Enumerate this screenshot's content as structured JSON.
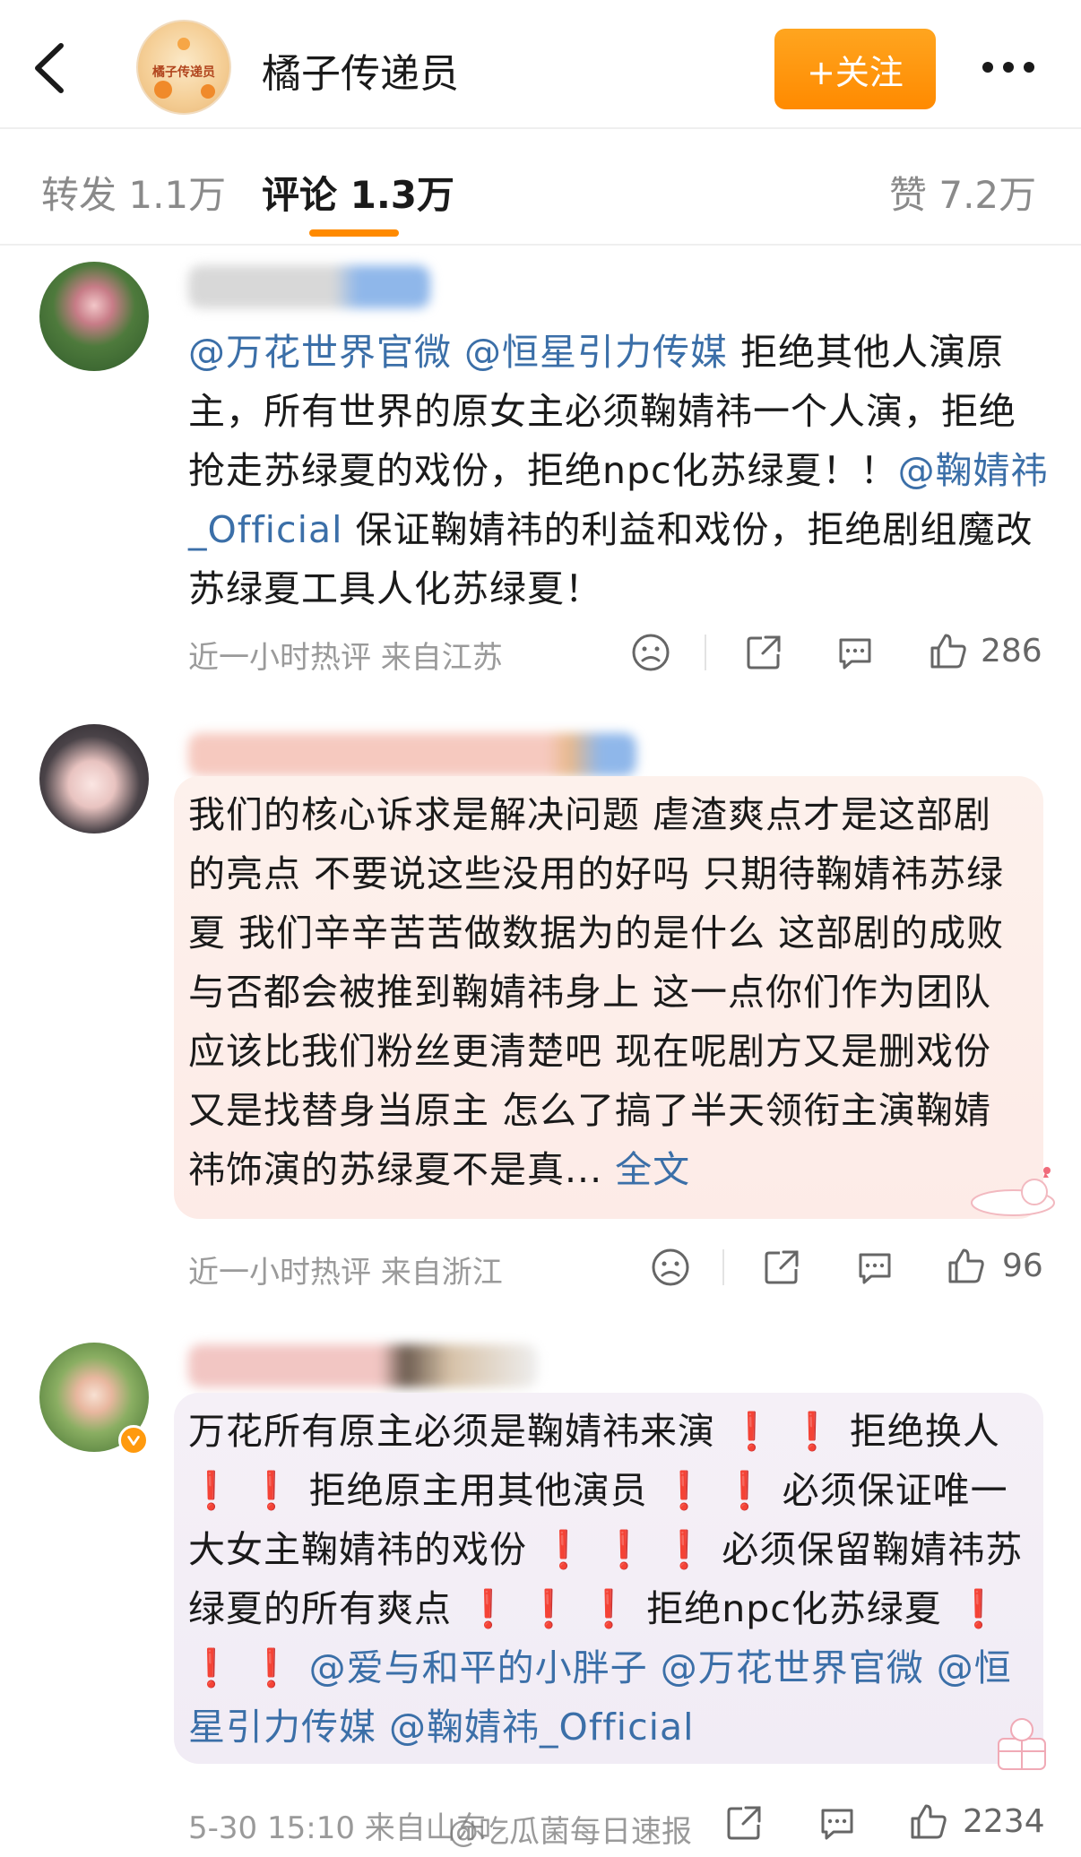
{
  "header": {
    "title": "橘子传递员",
    "avatar_text": "橘子传递员",
    "follow_label": "+关注"
  },
  "tabs": {
    "repost": "转发 1.1万",
    "comments": "评论 1.3万",
    "likes": "赞 7.2万"
  },
  "comments": [
    {
      "segments": [
        {
          "type": "mention",
          "text": "@万花世界官微"
        },
        {
          "type": "text",
          "text": " "
        },
        {
          "type": "mention",
          "text": "@恒星引力传媒"
        },
        {
          "type": "text",
          "text": " 拒绝其他人演原主，所有世界的原女主必须鞠婧祎一个人演，拒绝抢走苏绿夏的戏份，拒绝npc化苏绿夏！！"
        },
        {
          "type": "mention",
          "text": "@鞠婧祎_Official"
        },
        {
          "type": "text",
          "text": " 保证鞠婧祎的利益和戏份，拒绝剧组魔改苏绿夏工具人化苏绿夏！"
        }
      ],
      "meta": "近一小时热评  来自江苏",
      "likes": "286"
    },
    {
      "segments": [
        {
          "type": "text",
          "text": "我们的核心诉求是解决问题 虐渣爽点才是这部剧的亮点 不要说这些没用的好吗 只期待鞠婧祎苏绿夏 我们辛辛苦苦做数据为的是什么 这部剧的成败与否都会被推到鞠婧祎身上 这一点你们作为团队应该比我们粉丝更清楚吧 现在呢剧方又是删戏份又是找替身当原主 怎么了搞了半天领衔主演鞠婧祎饰演的苏绿夏不是真..."
        },
        {
          "type": "fulltext",
          "text": " 全文"
        }
      ],
      "meta": "近一小时热评  来自浙江",
      "likes": "96"
    },
    {
      "segments": [
        {
          "type": "text",
          "text": "万花所有原主必须是鞠婧祎来演"
        },
        {
          "type": "emoji",
          "text": " ❗ ❗ "
        },
        {
          "type": "text",
          "text": "拒绝换人"
        },
        {
          "type": "emoji",
          "text": " ❗ ❗ "
        },
        {
          "type": "text",
          "text": "拒绝原主用其他演员"
        },
        {
          "type": "emoji",
          "text": " ❗ ❗ "
        },
        {
          "type": "text",
          "text": "必须保证唯一大女主鞠婧祎的戏份"
        },
        {
          "type": "emoji",
          "text": " ❗ ❗ ❗ "
        },
        {
          "type": "text",
          "text": "必须保留鞠婧祎苏绿夏的所有爽点"
        },
        {
          "type": "emoji",
          "text": " ❗ ❗ ❗ "
        },
        {
          "type": "text",
          "text": "拒绝npc化苏绿夏"
        },
        {
          "type": "emoji",
          "text": " ❗ ❗ ❗ "
        },
        {
          "type": "mention",
          "text": "@爱与和平的小胖子"
        },
        {
          "type": "text",
          "text": " "
        },
        {
          "type": "mention",
          "text": "@万花世界官微"
        },
        {
          "type": "text",
          "text": " "
        },
        {
          "type": "mention",
          "text": "@恒星引力传媒"
        },
        {
          "type": "text",
          "text": " "
        },
        {
          "type": "mention",
          "text": "@鞠婧祎_Official"
        }
      ],
      "meta": "5-30 15:10 来自山东",
      "likes": "2234"
    }
  ],
  "watermark": "@吃瓜菌每日速报",
  "colors": {
    "accent_orange": "#ff8a00",
    "mention_blue": "#3b6fa8",
    "meta_gray": "#9a9a9a",
    "bubble_pink": "#fdeeea",
    "bubble_lavender": "#f3eef6"
  },
  "icons": [
    "back-chevron-icon",
    "more-dots-icon",
    "dislike-face-icon",
    "share-icon",
    "comment-icon",
    "thumbs-up-icon"
  ]
}
